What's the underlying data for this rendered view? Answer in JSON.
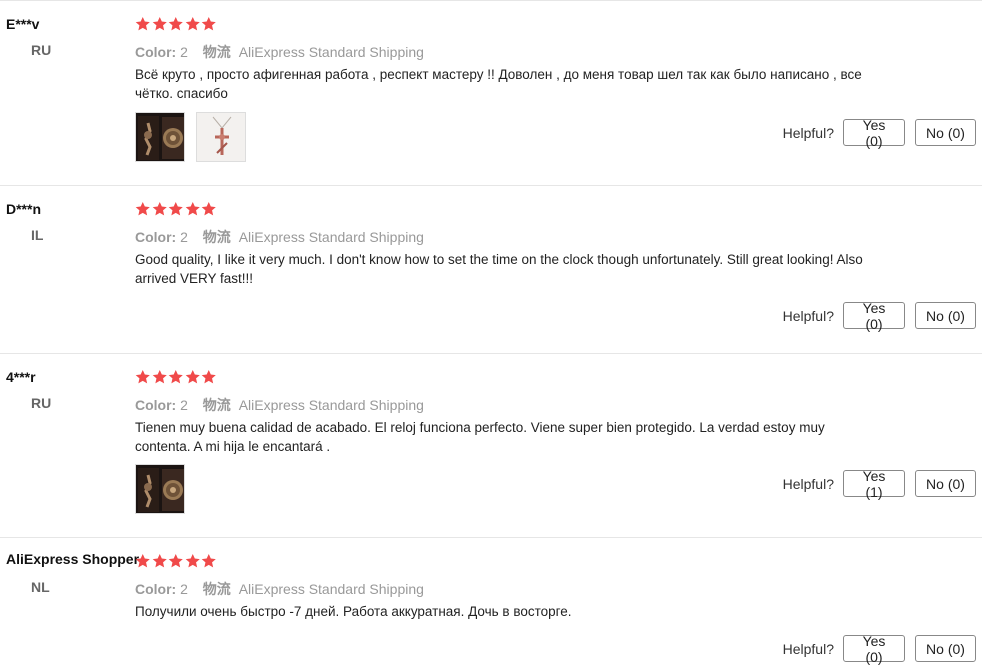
{
  "reviews": [
    {
      "user": "E***v",
      "country": "RU",
      "rating": 5,
      "color_label": "Color:",
      "color_value": "2",
      "shipping_label": "物流",
      "shipping_value": "AliExpress Standard Shipping",
      "text": "Всё круто , просто афигенная работа , респект мастеру !! Доволен , до меня товар шел так как было написано , все чётко. спасибо",
      "photos": [
        "pocket-watch-box-photo",
        "cross-necklace-photo"
      ],
      "helpful_label": "Helpful?",
      "yes_label": "Yes (0)",
      "no_label": "No (0)"
    },
    {
      "user": "D***n",
      "country": "IL",
      "rating": 5,
      "color_label": "Color:",
      "color_value": "2",
      "shipping_label": "物流",
      "shipping_value": "AliExpress Standard Shipping",
      "text": "Good quality, I like it very much. I don't know how to set the time on the clock though unfortunately. Still great looking! Also arrived VERY fast!!!",
      "photos": [],
      "helpful_label": "Helpful?",
      "yes_label": "Yes (0)",
      "no_label": "No (0)"
    },
    {
      "user": "4***r",
      "country": "RU",
      "rating": 5,
      "color_label": "Color:",
      "color_value": "2",
      "shipping_label": "物流",
      "shipping_value": "AliExpress Standard Shipping",
      "text": "Tienen muy buena calidad de acabado. El reloj funciona perfecto. Viene super bien protegido. La verdad estoy muy contenta. A mi hija le encantará .",
      "photos": [
        "pocket-watch-box-photo"
      ],
      "helpful_label": "Helpful?",
      "yes_label": "Yes (1)",
      "no_label": "No (0)"
    },
    {
      "user": "AliExpress Shopper",
      "country": "NL",
      "rating": 5,
      "color_label": "Color:",
      "color_value": "2",
      "shipping_label": "物流",
      "shipping_value": "AliExpress Standard Shipping",
      "text": "Получили очень быстро -7 дней. Работа аккуратная. Дочь в восторге.",
      "photos": [],
      "helpful_label": "Helpful?",
      "yes_label": "Yes (0)",
      "no_label": "No (0)"
    }
  ],
  "colors": {
    "star": "#f04a4a",
    "muted": "#999999",
    "divider": "#e6e6e6"
  }
}
